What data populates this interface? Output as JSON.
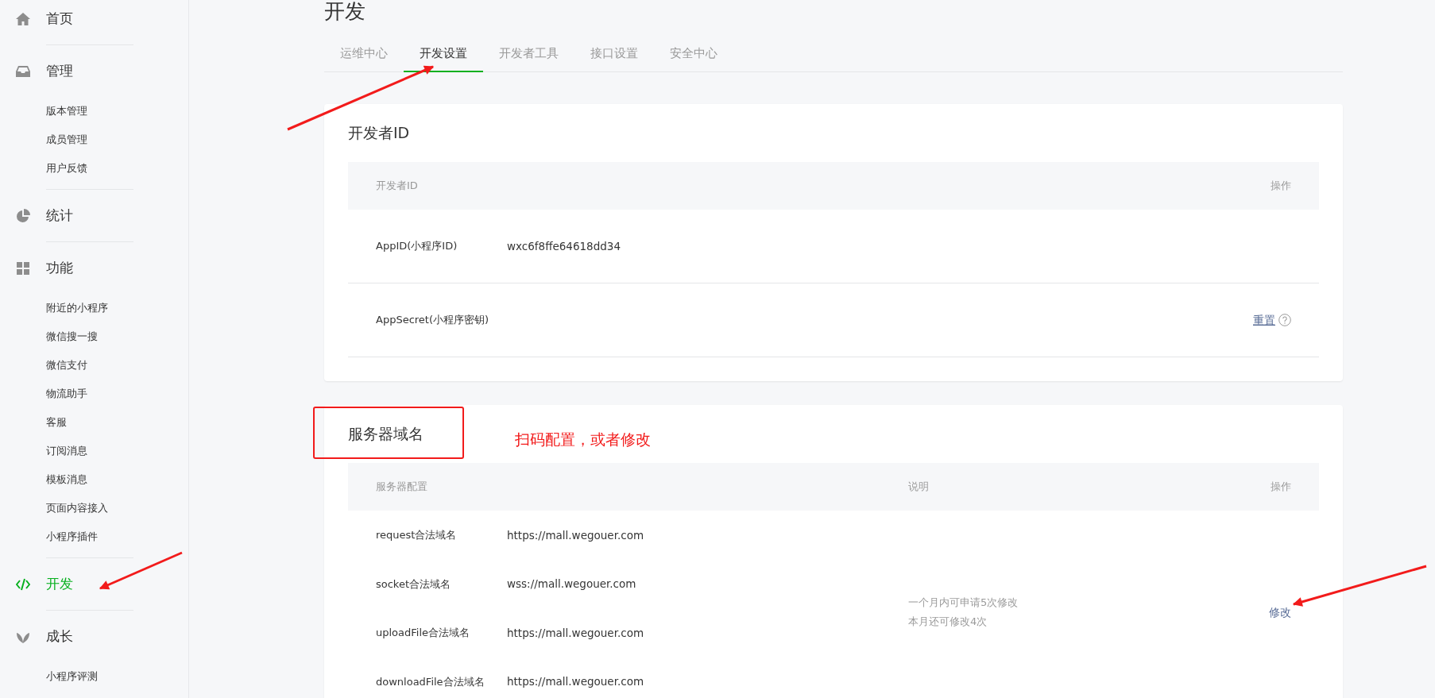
{
  "sidebar": {
    "items": [
      {
        "label": "首页",
        "selected": false
      },
      {
        "label": "管理",
        "selected": false,
        "children": [
          {
            "label": "版本管理"
          },
          {
            "label": "成员管理"
          },
          {
            "label": "用户反馈"
          }
        ]
      },
      {
        "label": "统计",
        "selected": false
      },
      {
        "label": "功能",
        "selected": false,
        "children": [
          {
            "label": "附近的小程序"
          },
          {
            "label": "微信搜一搜"
          },
          {
            "label": "微信支付"
          },
          {
            "label": "物流助手"
          },
          {
            "label": "客服"
          },
          {
            "label": "订阅消息"
          },
          {
            "label": "模板消息"
          },
          {
            "label": "页面内容接入"
          },
          {
            "label": "小程序插件"
          }
        ]
      },
      {
        "label": "开发",
        "selected": true
      },
      {
        "label": "成长",
        "selected": false,
        "children": [
          {
            "label": "小程序评测"
          }
        ]
      }
    ]
  },
  "page_title": "开发",
  "tabs": [
    {
      "label": "运维中心",
      "selected": false
    },
    {
      "label": "开发设置",
      "selected": true
    },
    {
      "label": "开发者工具",
      "selected": false
    },
    {
      "label": "接口设置",
      "selected": false
    },
    {
      "label": "安全中心",
      "selected": false
    }
  ],
  "developer_id": {
    "title": "开发者ID",
    "columns": [
      "开发者ID",
      "操作"
    ],
    "rows": [
      {
        "label": "AppID(小程序ID)",
        "value": "wxc6f8ffe64618dd34"
      },
      {
        "label": "AppSecret(小程序密钥)",
        "action": "重置"
      }
    ]
  },
  "server_domain": {
    "title": "服务器域名",
    "columns": [
      "服务器配置",
      "说明",
      "操作"
    ],
    "rows": [
      {
        "label": "request合法域名",
        "value": "https://mall.wegouer.com"
      },
      {
        "label": "socket合法域名",
        "value": "wss://mall.wegouer.com"
      },
      {
        "label": "uploadFile合法域名",
        "value": "https://mall.wegouer.com"
      },
      {
        "label": "downloadFile合法域名",
        "value": "https://mall.wegouer.com"
      }
    ],
    "notes": [
      "一个月内可申请5次修改",
      "本月还可修改4次"
    ],
    "action": "修改"
  },
  "annotation": {
    "text": "扫码配置，或者修改"
  }
}
